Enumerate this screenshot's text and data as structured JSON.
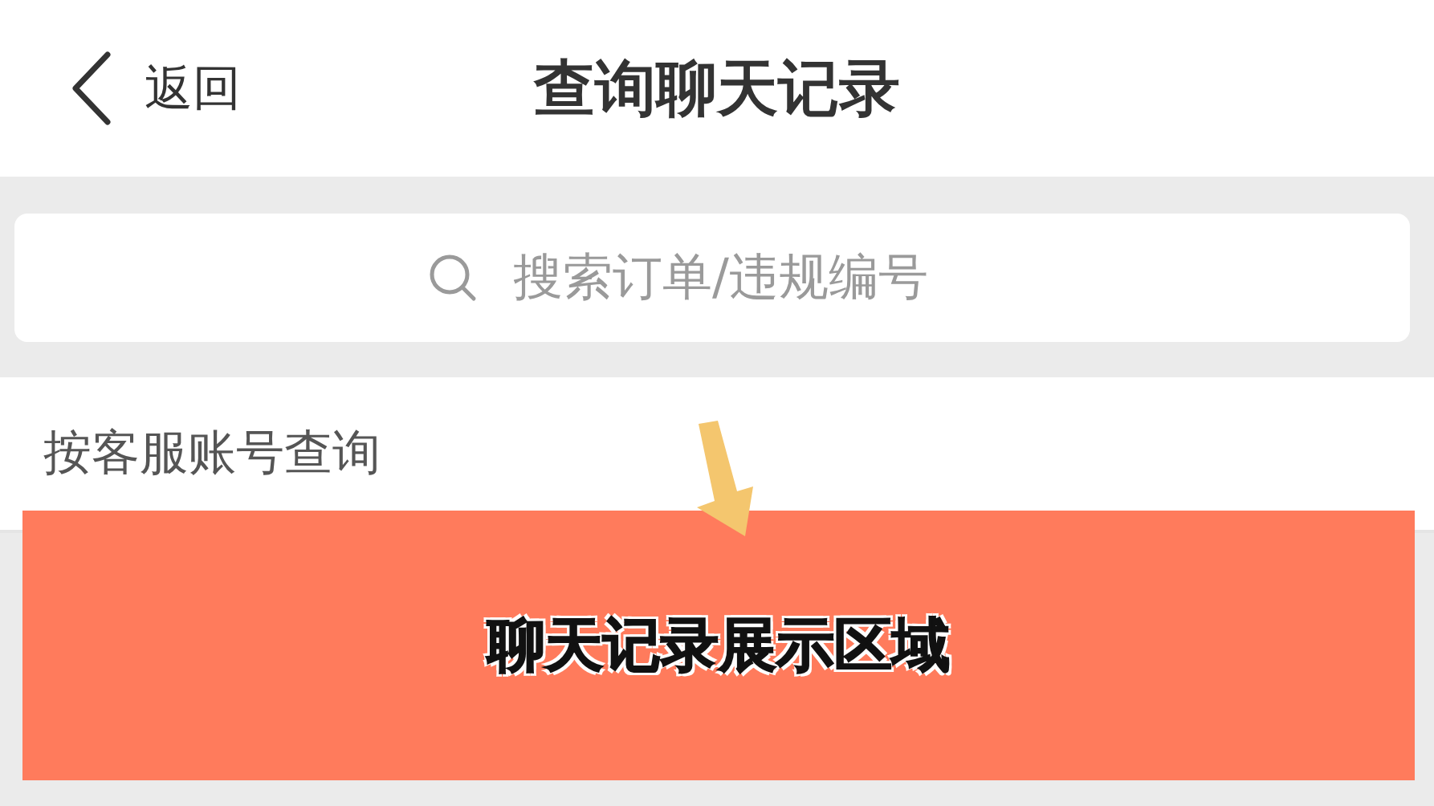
{
  "header": {
    "back_label": "返回",
    "title": "查询聊天记录"
  },
  "search": {
    "placeholder": "搜索订单/违规编号"
  },
  "query_row": {
    "label": "按客服账号查询"
  },
  "overlay": {
    "label": "聊天记录展示区域"
  }
}
